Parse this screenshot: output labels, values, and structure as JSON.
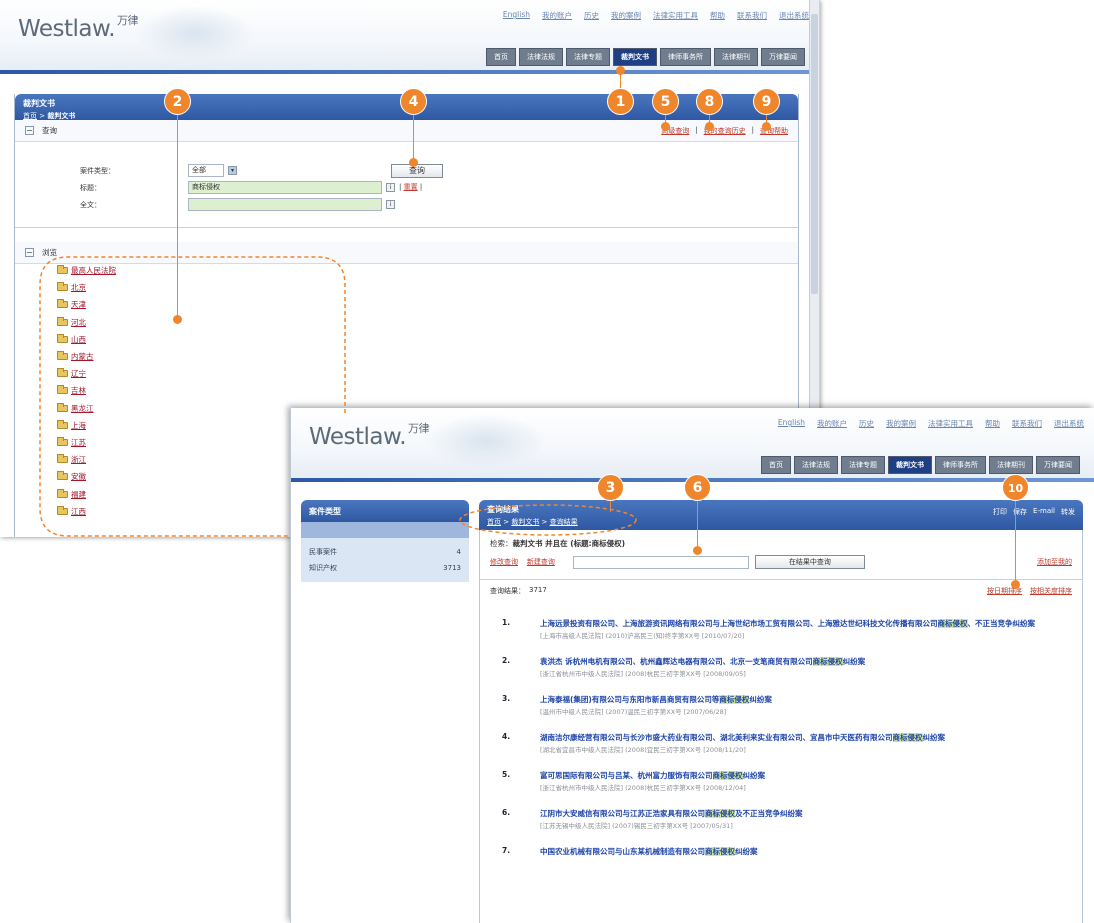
{
  "header": {
    "logo": "Westlaw.",
    "logo_cn": "万律",
    "top_links": [
      "English",
      "我的账户",
      "历史",
      "我的案例",
      "法律实用工具",
      "帮助",
      "联系我们",
      "退出系统"
    ],
    "tabs": [
      "首页",
      "法律法规",
      "法律专题",
      "裁判文书",
      "律师事务所",
      "法律期刊",
      "万律要闻"
    ],
    "tabs2": [
      "首页",
      "法律法规",
      "法律专题",
      "裁判文书",
      "律师事务所",
      "法律期刊",
      "万律要闻"
    ]
  },
  "page1": {
    "title": "裁判文书",
    "breadcrumb": [
      "首页",
      "裁判文书"
    ],
    "search_section": "查询",
    "right_links": [
      "高级查询",
      "我的查询历史",
      "查询帮助"
    ],
    "form": {
      "type_label": "案件类型：",
      "type_value": "全部",
      "title_label": "标题：",
      "title_value": "商标侵权",
      "full_label": "全文：",
      "full_value": ""
    },
    "search_btn": "查询",
    "reset_link": "重置",
    "browse_section": "浏览",
    "tree": [
      "最高人民法院",
      "北京",
      "天津",
      "河北",
      "山西",
      "内蒙古",
      "辽宁",
      "吉林",
      "黑龙江",
      "上海",
      "江苏",
      "浙江",
      "安徽",
      "福建",
      "江西"
    ]
  },
  "page2": {
    "sidebar": {
      "title": "案件类型",
      "rows": [
        {
          "label": "民事案件",
          "count": "4"
        },
        {
          "label": "知识产权",
          "count": "3713"
        }
      ]
    },
    "results": {
      "title": "查询结果",
      "breadcrumb": [
        "首页",
        "裁判文书",
        "查询结果"
      ],
      "tools": [
        "打印",
        "保存",
        "E-mail",
        "转发"
      ],
      "query_prefix": "检索：",
      "query_text": "裁判文书 并且在 (标题:商标侵权)",
      "links": [
        "修改查询",
        "新建查询"
      ],
      "search_in_btn": "在结果中查询",
      "right_link": "添加至我的",
      "count_label": "查询结果：",
      "count": "3717",
      "sort_links": [
        "按日期排序",
        "按相关度排序"
      ],
      "items": [
        {
          "num": "1.",
          "title": "上海远景投资有限公司、上海旅游资讯网络有限公司与上海世纪市场工贸有限公司、上海雅达世纪科技文化传播有限公司",
          "hl": "商标侵权",
          "tail": "、不正当竞争纠纷案",
          "src": "[上海市高级人民法院] (2010)沪高民三(知)终字第XX号 [2010/07/20]"
        },
        {
          "num": "2.",
          "title": "袁洪杰 诉杭州电机有限公司、杭州鑫辉达电器有限公司、北京一支笔商贸有限公司",
          "hl": "商标侵权",
          "tail": "纠纷案",
          "src": "[浙江省杭州市中级人民法院] (2008)杭民三初字第XX号 [2008/09/05]"
        },
        {
          "num": "3.",
          "title": "上海泰福(集团)有限公司与东阳市新昌商贸有限公司等",
          "hl": "商标侵权",
          "tail": "纠纷案",
          "src": "[温州市中级人民法院] (2007)温民三初字第XX号 [2007/06/28]"
        },
        {
          "num": "4.",
          "title": "湖南洁尔康经营有限公司与长沙市盛大药业有限公司、湖北美利来实业有限公司、宜昌市中天医药有限公司",
          "hl": "商标侵权",
          "tail": "纠纷案",
          "src": "[湖北省宜昌市中级人民法院] (2008)宜民三初字第XX号 [2008/11/20]"
        },
        {
          "num": "5.",
          "title": "富可思国际有限公司与吕某、杭州富力服饰有限公司",
          "hl": "商标侵权",
          "tail": "纠纷案",
          "src": "[浙江省杭州市中级人民法院] (2008)杭民三初字第XX号 [2008/12/04]"
        },
        {
          "num": "6.",
          "title": "江阴市大安威信有限公司与江苏正浩家具有限公司",
          "hl": "商标侵权",
          "tail": "及不正当竞争纠纷案",
          "src": "[江苏无锡中级人民法院] (2007)锡民三初字第XX号 [2007/05/31]"
        },
        {
          "num": "7.",
          "title": "中国农业机械有限公司与山东某机械制造有限公司",
          "hl": "商标侵权",
          "tail": "纠纷案",
          "src": ""
        }
      ]
    }
  },
  "callouts": [
    "1",
    "2",
    "3",
    "4",
    "5",
    "6",
    "8",
    "9",
    "10"
  ],
  "colors": {
    "callout": "#f0862c",
    "header_blue": "#2f58a2",
    "link_red": "#c0392b",
    "result_blue": "#1f44a8",
    "highlight": "#d6ec97"
  }
}
